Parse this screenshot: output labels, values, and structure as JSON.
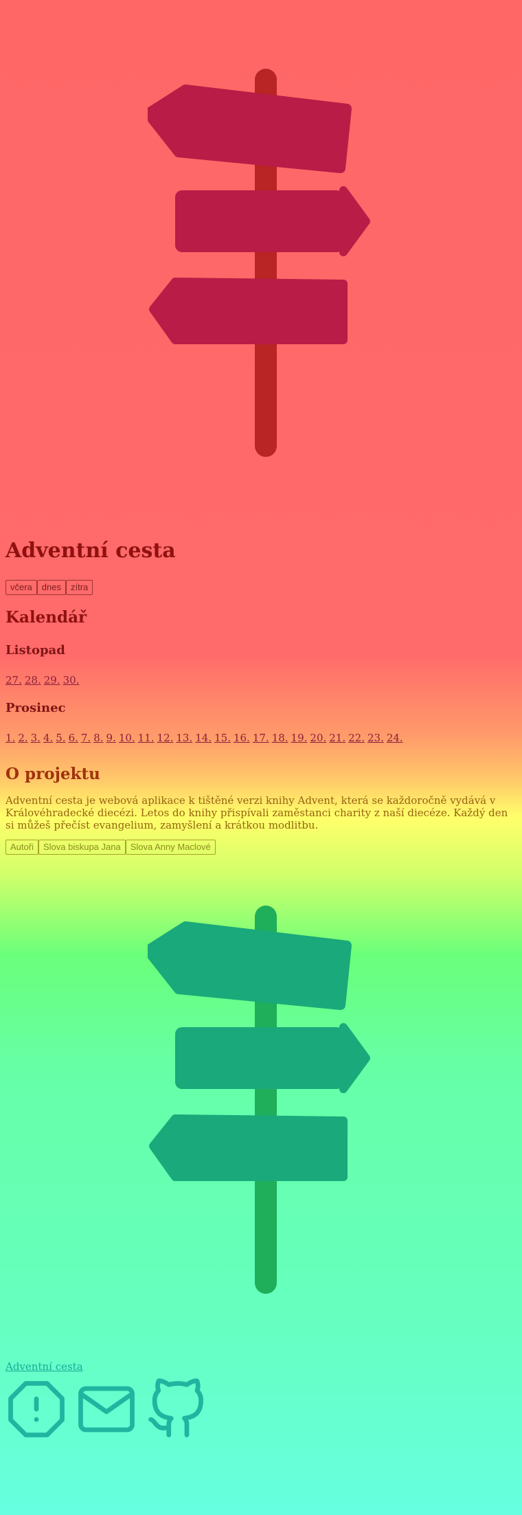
{
  "title": "Adventní cesta",
  "nav": {
    "yesterday": "včera",
    "today": "dnes",
    "tomorrow": "zítra"
  },
  "calendar": {
    "heading": "Kalendář",
    "november": {
      "label": "Listopad",
      "days": [
        "27.",
        "28.",
        "29.",
        "30."
      ]
    },
    "december": {
      "label": "Prosinec",
      "days": [
        "1.",
        "2.",
        "3.",
        "4.",
        "5.",
        "6.",
        "7.",
        "8.",
        "9.",
        "10.",
        "11.",
        "12.",
        "13.",
        "14.",
        "15.",
        "16.",
        "17.",
        "18.",
        "19.",
        "20.",
        "21.",
        "22.",
        "23.",
        "24."
      ]
    }
  },
  "about": {
    "heading": "O projektu",
    "text": "Adventní cesta je webová aplikace k tištěné verzi knihy Advent, která se každoročně vydává v Královéhradecké diecézi. Letos do knihy přispívali zaměstanci charity z naší diecéze. Každý den si můžeš přečíst evangelium, zamyšlení a krátkou modlitbu.",
    "links": [
      "Autoři",
      "Slova biskupa Jana",
      "Slova Anny Maclové"
    ]
  },
  "footer": {
    "link": "Adventní cesta",
    "icons": [
      "alert-octagon-icon",
      "mail-icon",
      "github-icon"
    ]
  },
  "colors": {
    "top_signpost": "#b91c46",
    "bottom_signpost": "#1aa97a",
    "heading": "#8f1111"
  }
}
